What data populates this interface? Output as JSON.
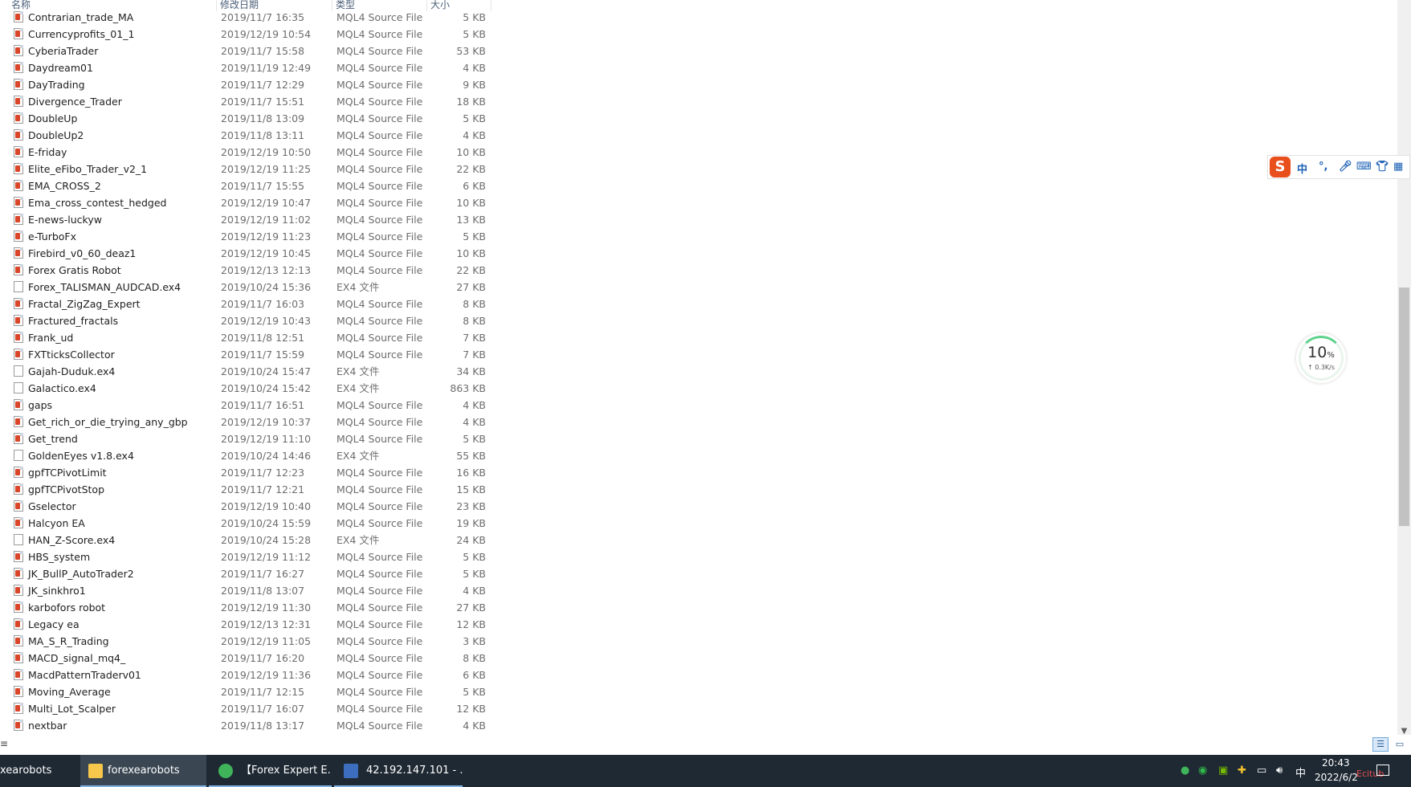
{
  "columns": {
    "name": "名称",
    "date": "修改日期",
    "type": "类型",
    "size": "大小"
  },
  "files": [
    {
      "name": "Contrarian_trade_MA",
      "date": "2019/11/7 16:35",
      "type": "MQL4 Source File",
      "size": "5 KB",
      "icon": "mq4-file-icon"
    },
    {
      "name": "Currencyprofits_01_1",
      "date": "2019/12/19 10:54",
      "type": "MQL4 Source File",
      "size": "5 KB",
      "icon": "mq4-file-icon"
    },
    {
      "name": "CyberiaTrader",
      "date": "2019/11/7 15:58",
      "type": "MQL4 Source File",
      "size": "53 KB",
      "icon": "mq4-file-icon"
    },
    {
      "name": "Daydream01",
      "date": "2019/11/19 12:49",
      "type": "MQL4 Source File",
      "size": "4 KB",
      "icon": "mq4-file-icon"
    },
    {
      "name": "DayTrading",
      "date": "2019/11/7 12:29",
      "type": "MQL4 Source File",
      "size": "9 KB",
      "icon": "mq4-file-icon"
    },
    {
      "name": "Divergence_Trader",
      "date": "2019/11/7 15:51",
      "type": "MQL4 Source File",
      "size": "18 KB",
      "icon": "mq4-file-icon"
    },
    {
      "name": "DoubleUp",
      "date": "2019/11/8 13:09",
      "type": "MQL4 Source File",
      "size": "5 KB",
      "icon": "mq4-file-icon"
    },
    {
      "name": "DoubleUp2",
      "date": "2019/11/8 13:11",
      "type": "MQL4 Source File",
      "size": "4 KB",
      "icon": "mq4-file-icon"
    },
    {
      "name": "E-friday",
      "date": "2019/12/19 10:50",
      "type": "MQL4 Source File",
      "size": "10 KB",
      "icon": "mq4-file-icon"
    },
    {
      "name": "Elite_eFibo_Trader_v2_1",
      "date": "2019/12/19 11:25",
      "type": "MQL4 Source File",
      "size": "22 KB",
      "icon": "mq4-file-icon"
    },
    {
      "name": "EMA_CROSS_2",
      "date": "2019/11/7 15:55",
      "type": "MQL4 Source File",
      "size": "6 KB",
      "icon": "mq4-file-icon"
    },
    {
      "name": "Ema_cross_contest_hedged",
      "date": "2019/12/19 10:47",
      "type": "MQL4 Source File",
      "size": "10 KB",
      "icon": "mq4-file-icon"
    },
    {
      "name": "E-news-luckyw",
      "date": "2019/12/19 11:02",
      "type": "MQL4 Source File",
      "size": "13 KB",
      "icon": "mq4-file-icon"
    },
    {
      "name": "e-TurboFx",
      "date": "2019/12/19 11:23",
      "type": "MQL4 Source File",
      "size": "5 KB",
      "icon": "mq4-file-icon"
    },
    {
      "name": "Firebird_v0_60_deaz1",
      "date": "2019/12/19 10:45",
      "type": "MQL4 Source File",
      "size": "10 KB",
      "icon": "mq4-file-icon"
    },
    {
      "name": "Forex Gratis Robot",
      "date": "2019/12/13 12:13",
      "type": "MQL4 Source File",
      "size": "22 KB",
      "icon": "mq4-file-icon"
    },
    {
      "name": "Forex_TALISMAN_AUDCAD.ex4",
      "date": "2019/10/24 15:36",
      "type": "EX4 文件",
      "size": "27 KB",
      "icon": "ex4-file-icon"
    },
    {
      "name": "Fractal_ZigZag_Expert",
      "date": "2019/11/7 16:03",
      "type": "MQL4 Source File",
      "size": "8 KB",
      "icon": "mq4-file-icon"
    },
    {
      "name": "Fractured_fractals",
      "date": "2019/12/19 10:43",
      "type": "MQL4 Source File",
      "size": "8 KB",
      "icon": "mq4-file-icon"
    },
    {
      "name": "Frank_ud",
      "date": "2019/11/8 12:51",
      "type": "MQL4 Source File",
      "size": "7 KB",
      "icon": "mq4-file-icon"
    },
    {
      "name": "FXTticksCollector",
      "date": "2019/11/7 15:59",
      "type": "MQL4 Source File",
      "size": "7 KB",
      "icon": "mq4-file-icon"
    },
    {
      "name": "Gajah-Duduk.ex4",
      "date": "2019/10/24 15:47",
      "type": "EX4 文件",
      "size": "34 KB",
      "icon": "ex4-file-icon"
    },
    {
      "name": "Galactico.ex4",
      "date": "2019/10/24 15:42",
      "type": "EX4 文件",
      "size": "863 KB",
      "icon": "ex4-file-icon"
    },
    {
      "name": "gaps",
      "date": "2019/11/7 16:51",
      "type": "MQL4 Source File",
      "size": "4 KB",
      "icon": "mq4-file-icon"
    },
    {
      "name": "Get_rich_or_die_trying_any_gbp",
      "date": "2019/12/19 10:37",
      "type": "MQL4 Source File",
      "size": "4 KB",
      "icon": "mq4-file-icon"
    },
    {
      "name": "Get_trend",
      "date": "2019/12/19 11:10",
      "type": "MQL4 Source File",
      "size": "5 KB",
      "icon": "mq4-file-icon"
    },
    {
      "name": "GoldenEyes v1.8.ex4",
      "date": "2019/10/24 14:46",
      "type": "EX4 文件",
      "size": "55 KB",
      "icon": "ex4-file-icon"
    },
    {
      "name": "gpfTCPivotLimit",
      "date": "2019/11/7 12:23",
      "type": "MQL4 Source File",
      "size": "16 KB",
      "icon": "mq4-file-icon"
    },
    {
      "name": "gpfTCPivotStop",
      "date": "2019/11/7 12:21",
      "type": "MQL4 Source File",
      "size": "15 KB",
      "icon": "mq4-file-icon"
    },
    {
      "name": "Gselector",
      "date": "2019/12/19 10:40",
      "type": "MQL4 Source File",
      "size": "23 KB",
      "icon": "mq4-file-icon"
    },
    {
      "name": "Halcyon EA",
      "date": "2019/10/24 15:59",
      "type": "MQL4 Source File",
      "size": "19 KB",
      "icon": "mq4-file-icon"
    },
    {
      "name": "HAN_Z-Score.ex4",
      "date": "2019/10/24 15:28",
      "type": "EX4 文件",
      "size": "24 KB",
      "icon": "ex4-file-icon"
    },
    {
      "name": "HBS_system",
      "date": "2019/12/19 11:12",
      "type": "MQL4 Source File",
      "size": "5 KB",
      "icon": "mq4-file-icon"
    },
    {
      "name": "JK_BullP_AutoTrader2",
      "date": "2019/11/7 16:27",
      "type": "MQL4 Source File",
      "size": "5 KB",
      "icon": "mq4-file-icon"
    },
    {
      "name": "JK_sinkhro1",
      "date": "2019/11/8 13:07",
      "type": "MQL4 Source File",
      "size": "4 KB",
      "icon": "mq4-file-icon"
    },
    {
      "name": "karbofors robot",
      "date": "2019/12/19 11:30",
      "type": "MQL4 Source File",
      "size": "27 KB",
      "icon": "mq4-file-icon"
    },
    {
      "name": "Legacy ea",
      "date": "2019/12/13 12:31",
      "type": "MQL4 Source File",
      "size": "12 KB",
      "icon": "mq4-file-icon"
    },
    {
      "name": "MA_S_R_Trading",
      "date": "2019/12/19 11:05",
      "type": "MQL4 Source File",
      "size": "3 KB",
      "icon": "mq4-file-icon"
    },
    {
      "name": "MACD_signal_mq4_",
      "date": "2019/11/7 16:20",
      "type": "MQL4 Source File",
      "size": "8 KB",
      "icon": "mq4-file-icon"
    },
    {
      "name": "MacdPatternTraderv01",
      "date": "2019/12/19 11:36",
      "type": "MQL4 Source File",
      "size": "6 KB",
      "icon": "mq4-file-icon"
    },
    {
      "name": "Moving_Average",
      "date": "2019/11/7 12:15",
      "type": "MQL4 Source File",
      "size": "5 KB",
      "icon": "mq4-file-icon"
    },
    {
      "name": "Multi_Lot_Scalper",
      "date": "2019/11/7 16:07",
      "type": "MQL4 Source File",
      "size": "12 KB",
      "icon": "mq4-file-icon"
    },
    {
      "name": "nextbar",
      "date": "2019/11/8 13:17",
      "type": "MQL4 Source File",
      "size": "4 KB",
      "icon": "mq4-file-icon"
    }
  ],
  "ime": {
    "logo": "S",
    "mode": "中",
    "punct": "°,",
    "voice_icon": "microphone-icon",
    "keyboard_icon": "keyboard-icon",
    "skin_icon": "shirt-icon",
    "tools_icon": "grid-icon"
  },
  "net_meter": {
    "percent": "10",
    "unit": "%",
    "speed": "↑ 0.3K/s",
    "level": 0.1,
    "color": "#5fd38d"
  },
  "taskbar": {
    "tasks": [
      {
        "label": "xearobots"
      },
      {
        "label": "forexearobots"
      },
      {
        "label": "【Forex Expert E..."
      },
      {
        "label": "42.192.147.101 - ..."
      }
    ],
    "ime_indicator": "中",
    "clock_time": "20:43",
    "clock_date": "2022/6/2",
    "watermark": "Ecitub"
  },
  "colors": {
    "accent": "#7fb2e5",
    "taskbar": "#1f2933",
    "ime_brand": "#e94f1d",
    "mql_icon": "#d9462a"
  }
}
